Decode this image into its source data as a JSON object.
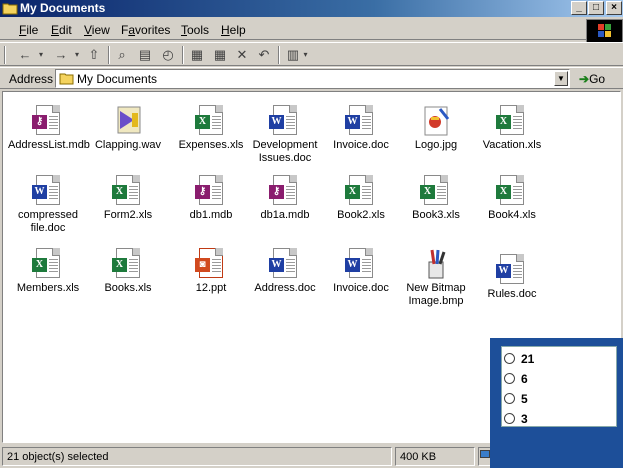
{
  "window": {
    "title": "My Documents"
  },
  "menu": [
    "File",
    "Edit",
    "View",
    "Favorites",
    "Tools",
    "Help"
  ],
  "menu_hotkeys": [
    "F",
    "E",
    "V",
    "a",
    "T",
    "H"
  ],
  "toolbar": {
    "back": "←",
    "forward": "→",
    "up": "⇧",
    "search": "⌕",
    "folders": "▤",
    "history": "◴",
    "move": "▦",
    "copy": "▦",
    "delete": "✕",
    "undo": "↶",
    "views": "▥"
  },
  "address": {
    "label": "Address",
    "value": "My Documents",
    "go": "Go"
  },
  "files": [
    {
      "name": "AddressList.mdb",
      "type": "mdb"
    },
    {
      "name": "Clapping.wav",
      "type": "wav"
    },
    {
      "name": "Expenses.xls",
      "type": "xls"
    },
    {
      "name": "Development Issues.doc",
      "type": "doc"
    },
    {
      "name": "Invoice.doc",
      "type": "doc"
    },
    {
      "name": "Logo.jpg",
      "type": "jpg"
    },
    {
      "name": "Vacation.xls",
      "type": "xls"
    },
    {
      "name": "compressed file.doc",
      "type": "doc"
    },
    {
      "name": "Form2.xls",
      "type": "xls"
    },
    {
      "name": "db1.mdb",
      "type": "mdb"
    },
    {
      "name": "db1a.mdb",
      "type": "mdb"
    },
    {
      "name": "Book2.xls",
      "type": "xls"
    },
    {
      "name": "Book3.xls",
      "type": "xls"
    },
    {
      "name": "Book4.xls",
      "type": "xls"
    },
    {
      "name": "Members.xls",
      "type": "xls"
    },
    {
      "name": "Books.xls",
      "type": "xls"
    },
    {
      "name": "12.ppt",
      "type": "ppt"
    },
    {
      "name": "Address.doc",
      "type": "doc"
    },
    {
      "name": "Invoice.doc",
      "type": "doc"
    },
    {
      "name": "New Bitmap Image.bmp",
      "type": "bmp"
    },
    {
      "name": "Rules.doc",
      "type": "doc"
    }
  ],
  "status": {
    "selection": "21 object(s) selected",
    "size": "400 KB"
  },
  "quiz": {
    "options": [
      "21",
      "6",
      "5",
      "3"
    ]
  },
  "colors": {
    "title_bar": "#0a246a",
    "quiz_bg": "#1d4f99",
    "xls": "#1e7a3c",
    "doc": "#1f3fa3",
    "mdb": "#8a1d6e",
    "ppt": "#d14a1f"
  }
}
